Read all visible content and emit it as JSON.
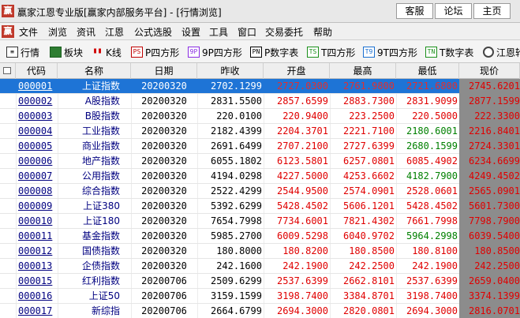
{
  "window": {
    "logo_char": "赢",
    "title": "赢家江恩专业版[赢家内部服务平台] - [行情浏览]",
    "buttons": [
      "客服",
      "论坛",
      "主页"
    ]
  },
  "menu": {
    "logo_char": "赢",
    "items": [
      "文件",
      "浏览",
      "资讯",
      "江恩",
      "公式选股",
      "设置",
      "工具",
      "窗口",
      "交易委托",
      "帮助"
    ]
  },
  "toolbar": {
    "items": [
      {
        "label": "行情",
        "icon": "list-icon",
        "glyph": "≡"
      },
      {
        "label": "板块",
        "icon": "block-icon",
        "glyph": ""
      },
      {
        "label": "K线",
        "icon": "candlestick-icon",
        "glyph": "▮▮"
      },
      {
        "label": "P四方形",
        "icon": "p-square-icon",
        "glyph": "PS"
      },
      {
        "label": "9P四方形",
        "icon": "9p-square-icon",
        "glyph": "9P"
      },
      {
        "label": "P数字表",
        "icon": "p-table-icon",
        "glyph": "PN"
      },
      {
        "label": "T四方形",
        "icon": "t-square-icon",
        "glyph": "TS"
      },
      {
        "label": "9T四方形",
        "icon": "9t-square-icon",
        "glyph": "T9"
      },
      {
        "label": "T数字表",
        "icon": "t-table-icon",
        "glyph": "TN"
      },
      {
        "label": "江恩轮",
        "icon": "gann-wheel-icon",
        "glyph": ""
      }
    ]
  },
  "table": {
    "columns": [
      "代码",
      "名称",
      "日期",
      "昨收",
      "开盘",
      "最高",
      "最低",
      "现价"
    ],
    "rows": [
      {
        "code": "000001",
        "name": "上证指数",
        "date": "20200320",
        "prev": "2702.1299",
        "open": "2727.0300",
        "high": "2761.9800",
        "low": "2721.6800",
        "cur": "2745.6201",
        "low_green": false
      },
      {
        "code": "000002",
        "name": "A股指数",
        "date": "20200320",
        "prev": "2831.5500",
        "open": "2857.6599",
        "high": "2883.7300",
        "low": "2831.9099",
        "cur": "2877.1599",
        "low_green": false
      },
      {
        "code": "000003",
        "name": "B股指数",
        "date": "20200320",
        "prev": "220.0100",
        "open": "220.9400",
        "high": "223.2500",
        "low": "220.5000",
        "cur": "222.3300",
        "low_green": false
      },
      {
        "code": "000004",
        "name": "工业指数",
        "date": "20200320",
        "prev": "2182.4399",
        "open": "2204.3701",
        "high": "2221.7100",
        "low": "2180.6001",
        "cur": "2216.8401",
        "low_green": true
      },
      {
        "code": "000005",
        "name": "商业指数",
        "date": "20200320",
        "prev": "2691.6499",
        "open": "2707.2100",
        "high": "2727.6399",
        "low": "2680.1599",
        "cur": "2724.3301",
        "low_green": true
      },
      {
        "code": "000006",
        "name": "地产指数",
        "date": "20200320",
        "prev": "6055.1802",
        "open": "6123.5801",
        "high": "6257.0801",
        "low": "6085.4902",
        "cur": "6234.6699",
        "low_green": false
      },
      {
        "code": "000007",
        "name": "公用指数",
        "date": "20200320",
        "prev": "4194.0298",
        "open": "4227.5000",
        "high": "4253.6602",
        "low": "4182.7900",
        "cur": "4249.4502",
        "low_green": true
      },
      {
        "code": "000008",
        "name": "综合指数",
        "date": "20200320",
        "prev": "2522.4299",
        "open": "2544.9500",
        "high": "2574.0901",
        "low": "2528.0601",
        "cur": "2565.0901",
        "low_green": false
      },
      {
        "code": "000009",
        "name": "上证380",
        "date": "20200320",
        "prev": "5392.6299",
        "open": "5428.4502",
        "high": "5606.1201",
        "low": "5428.4502",
        "cur": "5601.7300",
        "low_green": false
      },
      {
        "code": "000010",
        "name": "上证180",
        "date": "20200320",
        "prev": "7654.7998",
        "open": "7734.6001",
        "high": "7821.4302",
        "low": "7661.7998",
        "cur": "7798.7900",
        "low_green": false
      },
      {
        "code": "000011",
        "name": "基金指数",
        "date": "20200320",
        "prev": "5985.2700",
        "open": "6009.5298",
        "high": "6040.9702",
        "low": "5964.2998",
        "cur": "6039.5400",
        "low_green": true
      },
      {
        "code": "000012",
        "name": "国债指数",
        "date": "20200320",
        "prev": "180.8000",
        "open": "180.8200",
        "high": "180.8500",
        "low": "180.8100",
        "cur": "180.8500",
        "low_green": false
      },
      {
        "code": "000013",
        "name": "企债指数",
        "date": "20200320",
        "prev": "242.1600",
        "open": "242.1900",
        "high": "242.2500",
        "low": "242.1900",
        "cur": "242.2500",
        "low_green": false
      },
      {
        "code": "000015",
        "name": "红利指数",
        "date": "20200706",
        "prev": "2509.6299",
        "open": "2537.6399",
        "high": "2662.8101",
        "low": "2537.6399",
        "cur": "2659.0400",
        "low_green": false
      },
      {
        "code": "000016",
        "name": "上证50",
        "date": "20200706",
        "prev": "3159.1599",
        "open": "3198.7400",
        "high": "3384.8701",
        "low": "3198.7400",
        "cur": "3374.1399",
        "low_green": false
      },
      {
        "code": "000017",
        "name": "新综指",
        "date": "20200706",
        "prev": "2664.6799",
        "open": "2694.3000",
        "high": "2820.0801",
        "low": "2694.3000",
        "cur": "2816.0701",
        "low_green": false
      }
    ]
  }
}
